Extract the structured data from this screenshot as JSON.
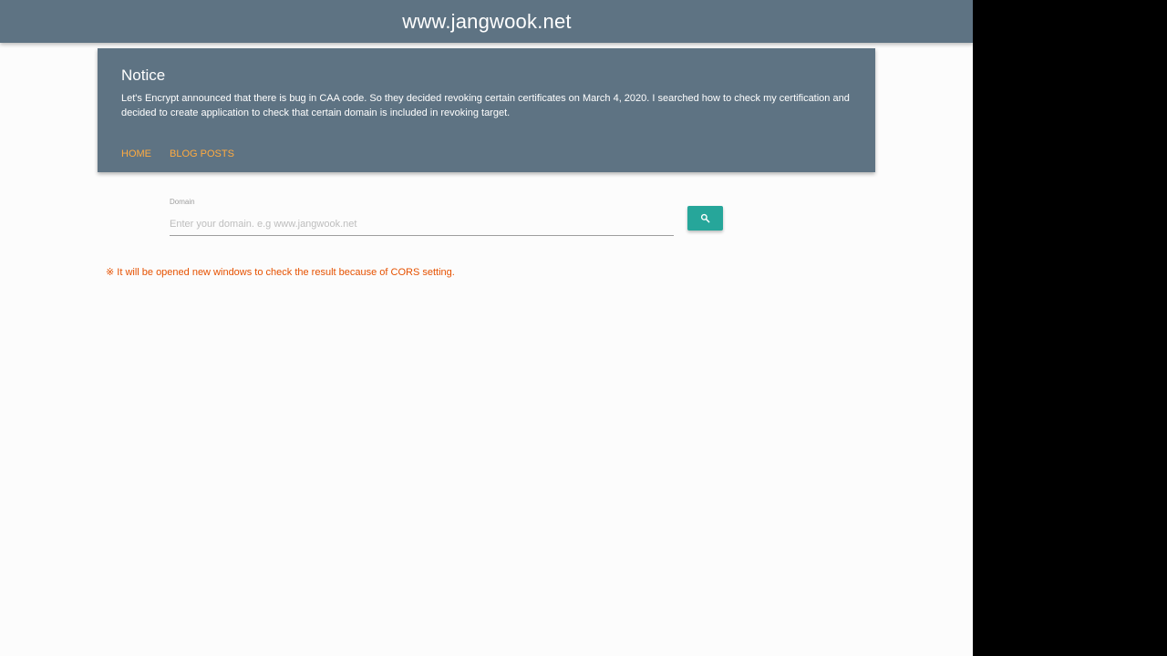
{
  "header": {
    "site_title": "www.jangwook.net",
    "bar_color": "#5e7383"
  },
  "notice": {
    "title": "Notice",
    "body": "Let's Encrypt announced that there is bug in CAA code. So they decided revoking certain certificates on March 4, 2020. I searched how to check my certification and decided to create application to check that certain domain is included in revoking target."
  },
  "nav": {
    "home_label": "HOME",
    "blog_posts_label": "BLOG POSTS",
    "link_color": "#ffab40"
  },
  "search": {
    "label": "Domain",
    "value": "",
    "placeholder": "Enter your domain. e.g www.jangwook.net",
    "button_icon": "search-icon",
    "button_color": "#26a69a"
  },
  "cors_note": "※ It will be opened new windows to check the result because of CORS setting."
}
